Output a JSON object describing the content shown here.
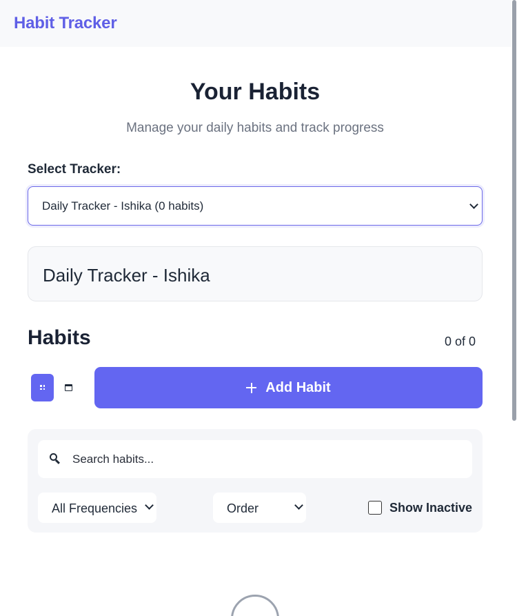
{
  "header": {
    "brand": "Habit Tracker"
  },
  "page": {
    "title": "Your Habits",
    "subtitle": "Manage your daily habits and track progress"
  },
  "tracker_select": {
    "label": "Select Tracker:",
    "value": "Daily Tracker - Ishika (0 habits)"
  },
  "tracker_card": {
    "title": "Daily Tracker - Ishika"
  },
  "habits": {
    "heading": "Habits",
    "count": "0 of 0",
    "add_label": "Add Habit"
  },
  "filters": {
    "search_placeholder": "Search habits...",
    "search_value": "",
    "frequency_value": "All Frequencies",
    "order_value": "Order",
    "show_inactive_label": "Show Inactive",
    "show_inactive_checked": false
  },
  "colors": {
    "accent": "#6366f1",
    "brand": "#5f5fe6",
    "panel_bg": "#f5f6f9",
    "header_bg": "#f8f9fb"
  },
  "icons": [
    "grid-view-icon",
    "calendar-icon",
    "plus-icon",
    "search-icon",
    "chevron-down-icon",
    "loading-spinner"
  ]
}
